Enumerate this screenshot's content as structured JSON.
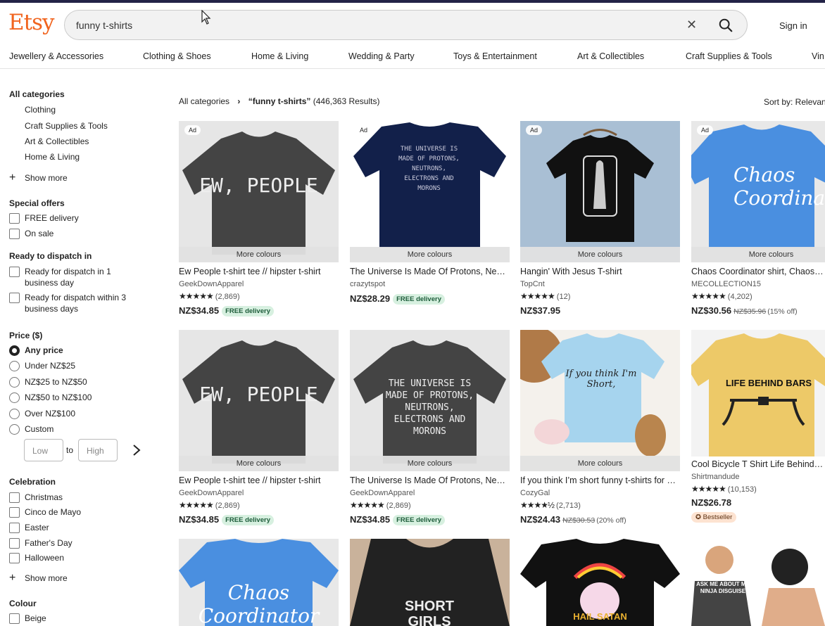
{
  "header": {
    "logo": "Etsy",
    "search_value": "funny t-shirts",
    "sign_in": "Sign in"
  },
  "nav": [
    "Jewellery & Accessories",
    "Clothing & Shoes",
    "Home & Living",
    "Wedding & Party",
    "Toys & Entertainment",
    "Art & Collectibles",
    "Craft Supplies & Tools",
    "Vin"
  ],
  "sidebar": {
    "all_categories": "All categories",
    "categories": [
      "Clothing",
      "Craft Supplies & Tools",
      "Art & Collectibles",
      "Home & Living"
    ],
    "show_more": "Show more",
    "special_offers": {
      "heading": "Special offers",
      "options": [
        "FREE delivery",
        "On sale"
      ]
    },
    "dispatch": {
      "heading": "Ready to dispatch in",
      "options": [
        [
          "Ready for dispatch in 1",
          "business day"
        ],
        [
          "Ready for dispatch within 3",
          "business days"
        ]
      ]
    },
    "price": {
      "heading": "Price ($)",
      "options": [
        "Any price",
        "Under NZ$25",
        "NZ$25 to NZ$50",
        "NZ$50 to NZ$100",
        "Over NZ$100",
        "Custom"
      ],
      "low_placeholder": "Low",
      "to": "to",
      "high_placeholder": "High"
    },
    "celebration": {
      "heading": "Celebration",
      "options": [
        "Christmas",
        "Cinco de Mayo",
        "Easter",
        "Father's Day",
        "Halloween"
      ]
    },
    "colour": {
      "heading": "Colour",
      "options": [
        "Beige"
      ]
    }
  },
  "results": {
    "breadcrumb_root": "All categories",
    "breadcrumb_sep": "›",
    "query": "“funny t-shirts”",
    "count": "(446,363 Results)",
    "sort": "Sort by: Relevancy"
  },
  "labels": {
    "ad": "Ad",
    "more_colours": "More colours",
    "free_delivery": "FREE delivery",
    "bestseller": "Bestseller",
    "stars_5": "★★★★★",
    "stars_45": "★★★★½"
  },
  "products": [
    {
      "title": "Ew People t-shirt tee // hipster t-shirt",
      "shop": "GeekDownApparel",
      "reviews": "(2,869)",
      "price": "NZ$34.85",
      "shirt_text": "EW, PEOPLE"
    },
    {
      "title": "The Universe Is Made Of Protons, Neutrons",
      "shop": "crazytspot",
      "price": "NZ$28.29",
      "shirt_text": "THE UNIVERSE IS MADE OF PROTONS, NEUTRONS, ELECTRONS AND MORONS"
    },
    {
      "title": "Hangin' With Jesus T-shirt",
      "shop": "TopCnt",
      "reviews": "(12)",
      "price": "NZ$37.95"
    },
    {
      "title": "Chaos Coordinator shirt, Chaos Coordinator",
      "shop": "MECOLLECTION15",
      "reviews": "(4,202)",
      "price": "NZ$30.56",
      "orig_price": "NZ$35.96",
      "discount": "(15% off)",
      "shirt_text": "Chaos Coordinator"
    },
    {
      "title": "Ew People t-shirt tee // hipster t-shirt",
      "shop": "GeekDownApparel",
      "reviews": "(2,869)",
      "price": "NZ$34.85",
      "shirt_text": "EW, PEOPLE"
    },
    {
      "title": "The Universe Is Made Of Protons, Neutrons",
      "shop": "GeekDownApparel",
      "reviews": "(2,869)",
      "price": "NZ$34.85",
      "shirt_text": "THE UNIVERSE IS MADE OF PROTONS, NEUTRONS, ELECTRONS AND MORONS"
    },
    {
      "title": "If you think I’m short funny t-shirts for women",
      "shop": "CozyGal",
      "reviews": "(2,713)",
      "price": "NZ$24.43",
      "orig_price": "NZ$30.53",
      "discount": "(20% off)",
      "shirt_text": "If you think I'm Short,"
    },
    {
      "title": "Cool Bicycle T Shirt Life Behind Bars",
      "shop": "Shirtmandude",
      "reviews": "(10,153)",
      "price": "NZ$26.78",
      "shirt_text": "LIFE BEHIND BARS"
    },
    {
      "shirt_text": "Chaos Coordinator"
    },
    {
      "shirt_text": "SHORT GIRLS"
    },
    {
      "shirt_text": "HAIL SATAN"
    },
    {
      "shirt_text": "ASK ME ABOUT MY NINJA DISGUISE"
    }
  ]
}
